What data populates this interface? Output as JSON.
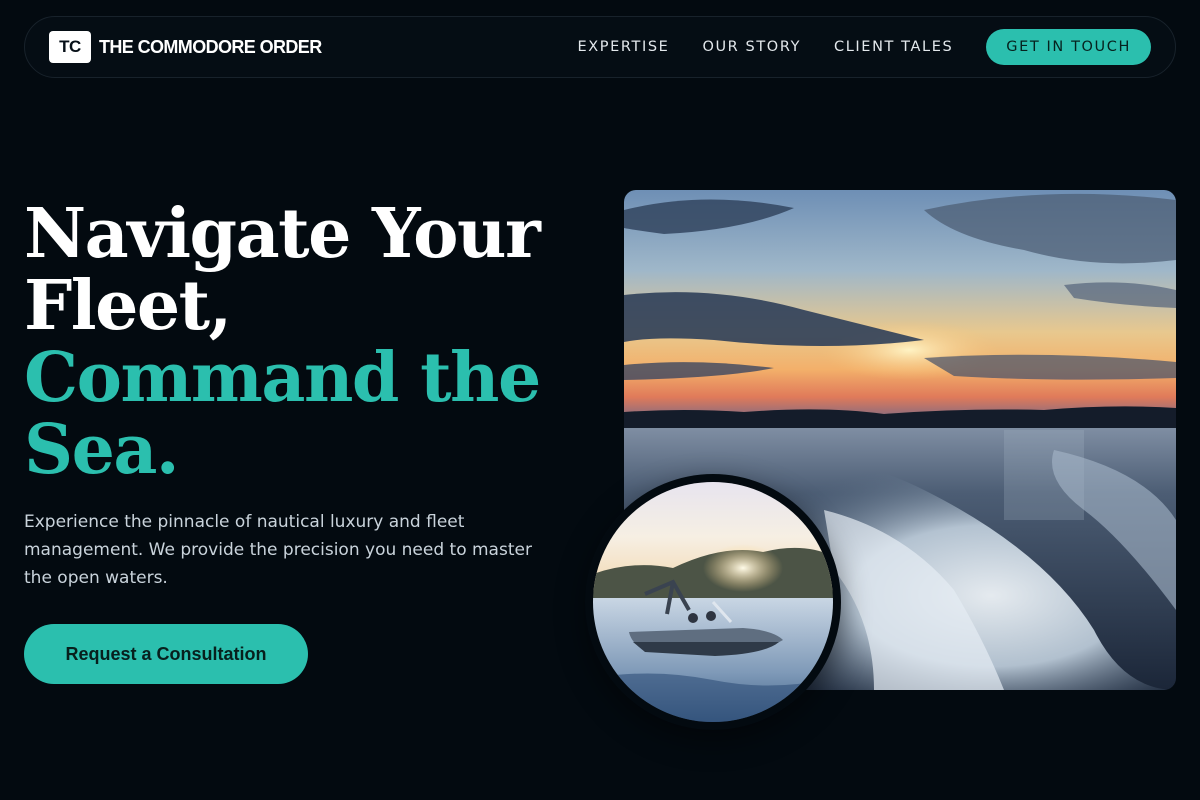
{
  "brand": {
    "mark": "TC",
    "name": "THE COMMODORE ORDER"
  },
  "nav": {
    "links": [
      "EXPERTISE",
      "OUR STORY",
      "CLIENT TALES"
    ],
    "cta": "GET IN TOUCH"
  },
  "hero": {
    "headline_white": [
      "Navigate Your",
      "Fleet,"
    ],
    "headline_teal": [
      "Command the",
      "Sea."
    ],
    "subtext": "Experience the pinnacle of nautical luxury and fleet management. We provide the precision you need to master the open waters.",
    "cta": "Request a Consultation"
  },
  "colors": {
    "background": "#030a10",
    "accent": "#2bbfae",
    "text": "#ffffff",
    "muted_text": "#c9d3db"
  },
  "images": {
    "main": "sunset-boat-wake-photo",
    "inset": "speedboat-sunset-photo"
  }
}
